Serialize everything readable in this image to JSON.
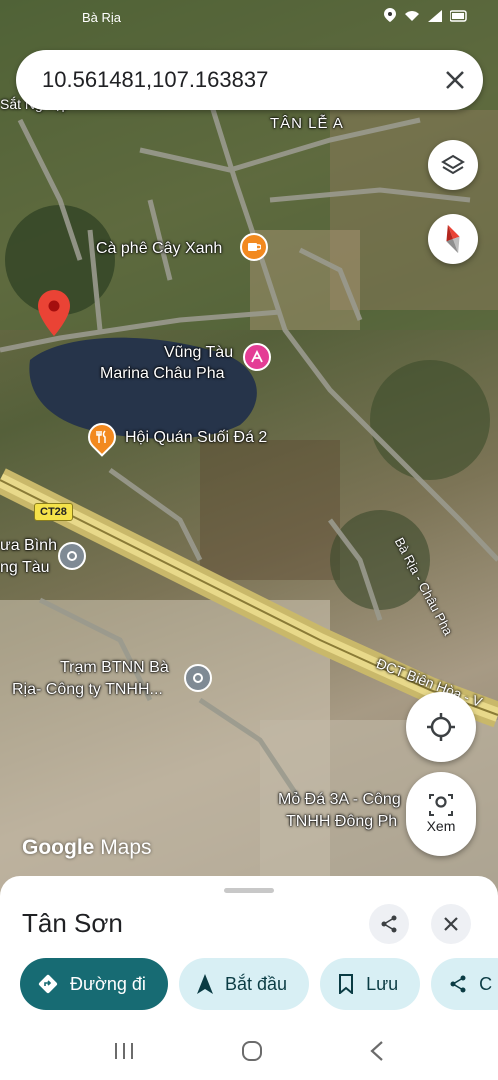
{
  "status_bar": {
    "left_text": "Bà Rịa"
  },
  "search": {
    "value": "10.561481,107.163837"
  },
  "map": {
    "labels": {
      "area_north": "TÂN LỄ A",
      "cafe": "Cà phê Cây Xanh",
      "marina_line1": "Vũng Tàu",
      "marina_line2": "Marina Châu Pha",
      "restaurant": "Hội Quán Suối Đá 2",
      "left_line1": "ưa Bình",
      "left_line2": "ng Tàu",
      "station_line1": "Trạm BTNN Bà",
      "station_line2": "Rịa- Công ty TNHH...",
      "quarry_line1": "Mỏ Đá 3A - Công",
      "quarry_line2": "TNHH Đông Ph",
      "road_top": "Sắt Nghiệp",
      "road_ba_ria": "Bà Rịa - Châu Pha",
      "road_expressway": "ĐCT Biên Hòa - V",
      "shield": "CT28"
    },
    "watermark_google": "Google",
    "watermark_maps": "Maps",
    "view_label": "Xem"
  },
  "sheet": {
    "title": "Tân Sơn",
    "chips": [
      {
        "label": "Đường đi",
        "icon": "directions-icon"
      },
      {
        "label": "Bắt đầu",
        "icon": "navigation-arrow-icon"
      },
      {
        "label": "Lưu",
        "icon": "bookmark-icon"
      },
      {
        "label": "C",
        "icon": "share-icon"
      }
    ]
  },
  "colors": {
    "primary_chip": "#176b73",
    "secondary_chip": "#d8eff4",
    "pin": "#ea4335",
    "poi_orange": "#f2891f",
    "poi_pink": "#e43d95"
  }
}
